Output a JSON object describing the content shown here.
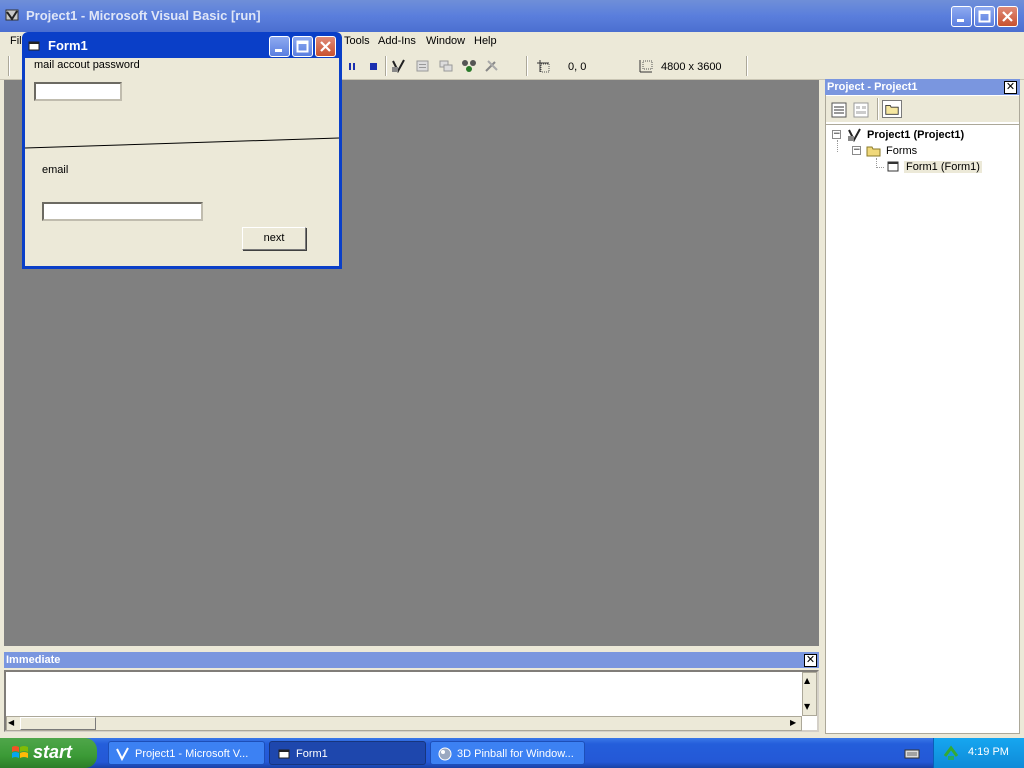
{
  "app": {
    "title": "Project1 - Microsoft Visual Basic [run]"
  },
  "menu": {
    "file": "File",
    "tools": "Tools",
    "addins": "Add-Ins",
    "window": "Window",
    "help": "Help"
  },
  "toolbar": {
    "position": "0, 0",
    "size": "4800 x 3600"
  },
  "form1": {
    "title": "Form1",
    "label_password": "mail accout password",
    "label_email": "email",
    "password_value": "",
    "email_value": "",
    "next_button": "next"
  },
  "project_panel": {
    "title": "Project - Project1",
    "tree_root": "Project1 (Project1)",
    "tree_folder": "Forms",
    "tree_item": "Form1 (Form1)"
  },
  "immediate": {
    "title": "Immediate"
  },
  "taskbar": {
    "start": "start",
    "tasks": [
      {
        "label": "Project1 - Microsoft V..."
      },
      {
        "label": "Form1"
      },
      {
        "label": "3D Pinball for Window..."
      }
    ],
    "clock": "4:19 PM"
  },
  "colors": {
    "title_blue": "#0a3fc8",
    "panel_head": "#7a96df",
    "mdi_gray": "#808080",
    "start_green": "#3b9a36"
  }
}
